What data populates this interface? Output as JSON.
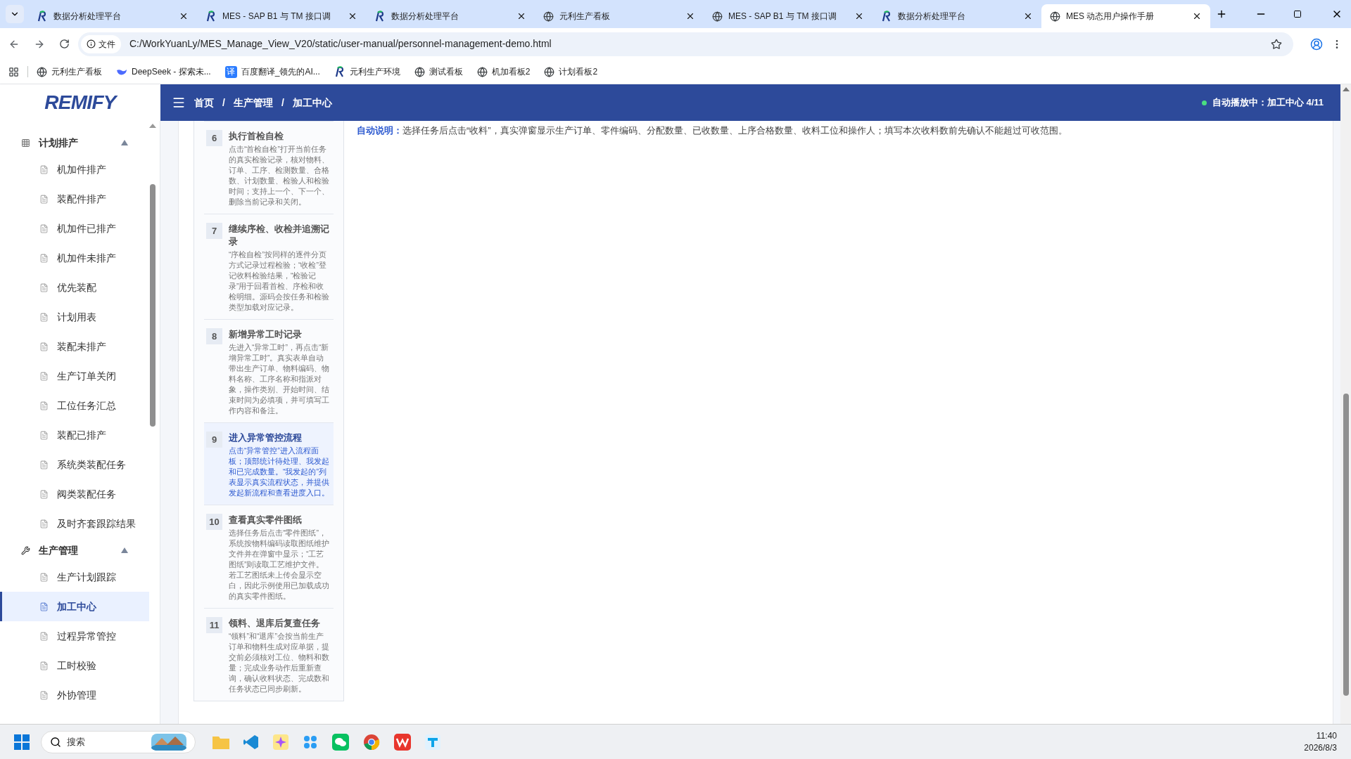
{
  "browser": {
    "tabs": [
      {
        "title": "数据分析处理平台",
        "kind": "app",
        "selected": false
      },
      {
        "title": "MES - SAP B1 与 TM 接口调",
        "kind": "app",
        "selected": false
      },
      {
        "title": "数据分析处理平台",
        "kind": "app",
        "selected": false
      },
      {
        "title": "元利生产看板",
        "kind": "globe",
        "selected": false
      },
      {
        "title": "MES - SAP B1 与 TM 接口调",
        "kind": "globe",
        "selected": false
      },
      {
        "title": "数据分析处理平台",
        "kind": "app",
        "selected": false
      },
      {
        "title": "MES 动态用户操作手册",
        "kind": "globe",
        "selected": true
      }
    ],
    "address": {
      "scheme": "文件",
      "url": "C:/WorkYuanLy/MES_Manage_View_V20/static/user-manual/personnel-management-demo.html"
    },
    "bookmarks": [
      {
        "label": "元利生产看板",
        "kind": "globe"
      },
      {
        "label": "DeepSeek - 探索未...",
        "kind": "whale"
      },
      {
        "label": "百度翻译_领先的AI...",
        "kind": "translate",
        "badge": "译"
      },
      {
        "label": "元利生产环境",
        "kind": "app"
      },
      {
        "label": "测试看板",
        "kind": "globe"
      },
      {
        "label": "机加看板2",
        "kind": "globe"
      },
      {
        "label": "计划看板2",
        "kind": "globe"
      }
    ]
  },
  "app": {
    "logo": "REMIFY",
    "breadcrumb": [
      "首页",
      "生产管理",
      "加工中心"
    ],
    "breadcrumb_separator": "/",
    "autoplay": "自动播放中：加工中心 4/11",
    "sidebar": [
      {
        "label": "计划排产",
        "kind": "grid",
        "expanded": true,
        "children": [
          {
            "label": "机加件排产",
            "selected": false
          },
          {
            "label": "装配件排产",
            "selected": false
          },
          {
            "label": "机加件已排产",
            "selected": false
          },
          {
            "label": "机加件未排产",
            "selected": false
          },
          {
            "label": "优先装配",
            "selected": false
          },
          {
            "label": "计划用表",
            "selected": false
          },
          {
            "label": "装配未排产",
            "selected": false
          },
          {
            "label": "生产订单关闭",
            "selected": false
          },
          {
            "label": "工位任务汇总",
            "selected": false
          },
          {
            "label": "装配已排产",
            "selected": false
          },
          {
            "label": "系统类装配任务",
            "selected": false
          },
          {
            "label": "阀类装配任务",
            "selected": false
          },
          {
            "label": "及时齐套跟踪结果",
            "selected": false
          }
        ]
      },
      {
        "label": "生产管理",
        "kind": "tools",
        "expanded": true,
        "children": [
          {
            "label": "生产计划跟踪",
            "selected": false
          },
          {
            "label": "加工中心",
            "selected": true
          },
          {
            "label": "过程异常管控",
            "selected": false
          },
          {
            "label": "工时校验",
            "selected": false
          },
          {
            "label": "外协管理",
            "selected": false
          }
        ]
      }
    ],
    "note": {
      "label": "自动说明：",
      "text": "选择任务后点击“收料”，真实弹窗显示生产订单、零件编码、分配数量、已收数量、上序合格数量、收料工位和操作人；填写本次收料数前先确认不能超过可收范围。"
    },
    "steps": [
      {
        "number": "6",
        "title": "执行首检自检",
        "description": "点击“首检自检”打开当前任务的真实检验记录，核对物料、订单、工序、检测数量、合格数、计划数量、检验人和检验时间；支持上一个、下一个、删除当前记录和关闭。",
        "selected": false
      },
      {
        "number": "7",
        "title": "继续序检、收检并追溯记录",
        "description": "“序检自检”按同样的逐件分页方式记录过程检验；“收检”登记收料检验结果，“检验记录”用于回看首检、序检和收检明细。源码会按任务和检验类型加载对应记录。",
        "selected": false
      },
      {
        "number": "8",
        "title": "新增异常工时记录",
        "description": "先进入“异常工时”，再点击“新增异常工时”。真实表单自动带出生产订单、物料编码、物料名称、工序名称和指派对象，操作类别、开始时间、结束时间为必填项，并可填写工作内容和备注。",
        "selected": false
      },
      {
        "number": "9",
        "title": "进入异常管控流程",
        "description": "点击“异常管控”进入流程面板；顶部统计待处理、我发起和已完成数量。“我发起的”列表显示真实流程状态，并提供发起新流程和查看进度入口。",
        "selected": true
      },
      {
        "number": "10",
        "title": "查看真实零件图纸",
        "description": "选择任务后点击“零件图纸”，系统按物料编码读取图纸维护文件并在弹窗中显示；“工艺图纸”则读取工艺维护文件。若工艺图纸未上传会显示空白，因此示例使用已加载成功的真实零件图纸。",
        "selected": false
      },
      {
        "number": "11",
        "title": "领料、退库后复查任务",
        "description": "“领料”和“退库”会按当前生产订单和物料生成对应单据，提交前必须核对工位、物料和数量；完成业务动作后重新查询，确认收料状态、完成数和任务状态已同步刷新。",
        "selected": false
      }
    ]
  },
  "taskbar": {
    "search_placeholder": "搜索",
    "time": "11:40",
    "date": "2026/8/3"
  }
}
